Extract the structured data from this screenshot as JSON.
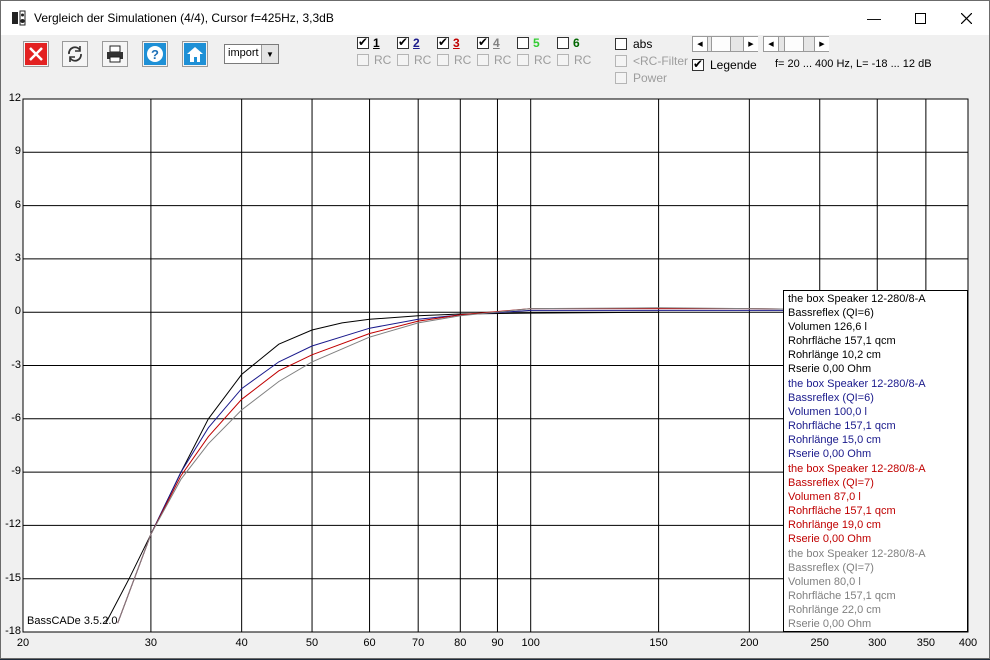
{
  "window": {
    "title": "Vergleich der Simulationen (4/4), Cursor f=425Hz, 3,3dB",
    "min_icon": "minimize-icon",
    "max_icon": "maximize-icon",
    "close_icon": "close-icon"
  },
  "toolbar": {
    "import_value": "import"
  },
  "series_toggles": [
    {
      "label": "1",
      "checked": true,
      "color": "#000000"
    },
    {
      "label": "2",
      "checked": true,
      "color": "#1a1a8c"
    },
    {
      "label": "3",
      "checked": true,
      "color": "#c00000"
    },
    {
      "label": "4",
      "checked": true,
      "color": "#808080"
    },
    {
      "label": "5",
      "checked": false,
      "color": "#33cc33"
    },
    {
      "label": "6",
      "checked": false,
      "color": "#006600"
    }
  ],
  "rc_label": "RC",
  "options": {
    "abs": "abs",
    "rc_filter": "<RC-Filter",
    "power": "Power",
    "legend": "Legende",
    "range_text": "f= 20 ... 400 Hz, L= -18 ... 12 dB"
  },
  "version_label": "BassCADe 3.5.2.0",
  "chart_data": {
    "type": "line",
    "title": "",
    "xlabel": "",
    "ylabel": "",
    "x_scale": "log",
    "xlim": [
      20,
      400
    ],
    "ylim": [
      -18,
      12
    ],
    "x_ticks": [
      20,
      30,
      40,
      50,
      60,
      70,
      80,
      90,
      100,
      150,
      200,
      250,
      300,
      350,
      400
    ],
    "y_ticks": [
      12,
      9,
      6,
      3,
      0,
      -3,
      -6,
      -9,
      -12,
      -15,
      -18
    ],
    "grid": true,
    "series": [
      {
        "color": "#000000",
        "x": [
          26,
          28,
          30,
          33,
          36,
          40,
          45,
          50,
          55,
          60,
          70,
          80,
          100,
          150
        ],
        "y": [
          -17.5,
          -15.0,
          -12.5,
          -9.0,
          -6.0,
          -3.5,
          -1.8,
          -1.0,
          -0.6,
          -0.4,
          -0.2,
          -0.1,
          -0.05,
          0.0
        ]
      },
      {
        "color": "#1a1a8c",
        "x": [
          27,
          30,
          33,
          36,
          40,
          45,
          50,
          60,
          70,
          80,
          100,
          150,
          200,
          250,
          300,
          400
        ],
        "y": [
          -17.5,
          -12.5,
          -9.0,
          -6.5,
          -4.3,
          -2.8,
          -1.9,
          -0.9,
          -0.4,
          -0.15,
          0.1,
          0.1,
          0.1,
          0.1,
          0.1,
          0.1
        ]
      },
      {
        "color": "#c00000",
        "x": [
          27,
          30,
          33,
          36,
          40,
          45,
          50,
          60,
          70,
          80,
          100,
          150,
          200,
          250,
          300,
          400
        ],
        "y": [
          -17.5,
          -12.5,
          -9.2,
          -7.0,
          -4.9,
          -3.3,
          -2.4,
          -1.2,
          -0.5,
          -0.15,
          0.2,
          0.2,
          0.2,
          0.15,
          0.1,
          0.1
        ]
      },
      {
        "color": "#808080",
        "x": [
          27,
          30,
          33,
          36,
          40,
          45,
          50,
          60,
          70,
          80,
          100,
          150,
          200,
          250,
          300,
          400
        ],
        "y": [
          -17.5,
          -12.5,
          -9.4,
          -7.4,
          -5.5,
          -3.9,
          -2.8,
          -1.4,
          -0.6,
          -0.2,
          0.2,
          0.25,
          0.2,
          0.15,
          0.1,
          0.1
        ]
      }
    ]
  },
  "legend_entries": [
    {
      "color": "#000000",
      "lines": [
        "the box Speaker 12-280/8-A",
        "Bassreflex (QI=6)",
        "Volumen 126,6 l",
        "Rohrfläche 157,1 qcm",
        "Rohrlänge 10,2 cm",
        "Rserie 0,00 Ohm"
      ]
    },
    {
      "color": "#1a1a8c",
      "lines": [
        "the box Speaker 12-280/8-A",
        "Bassreflex (QI=6)",
        "Volumen 100,0 l",
        "Rohrfläche 157,1 qcm",
        "Rohrlänge 15,0 cm",
        "Rserie 0,00 Ohm"
      ]
    },
    {
      "color": "#c00000",
      "lines": [
        "the box Speaker 12-280/8-A",
        "Bassreflex (QI=7)",
        "Volumen 87,0 l",
        "Rohrfläche 157,1 qcm",
        "Rohrlänge 19,0 cm",
        "Rserie 0,00 Ohm"
      ]
    },
    {
      "color": "#808080",
      "lines": [
        "the box Speaker 12-280/8-A",
        "Bassreflex (QI=7)",
        "Volumen 80,0 l",
        "Rohrfläche 157,1 qcm",
        "Rohrlänge 22,0 cm",
        "Rserie 0,00 Ohm"
      ]
    }
  ]
}
